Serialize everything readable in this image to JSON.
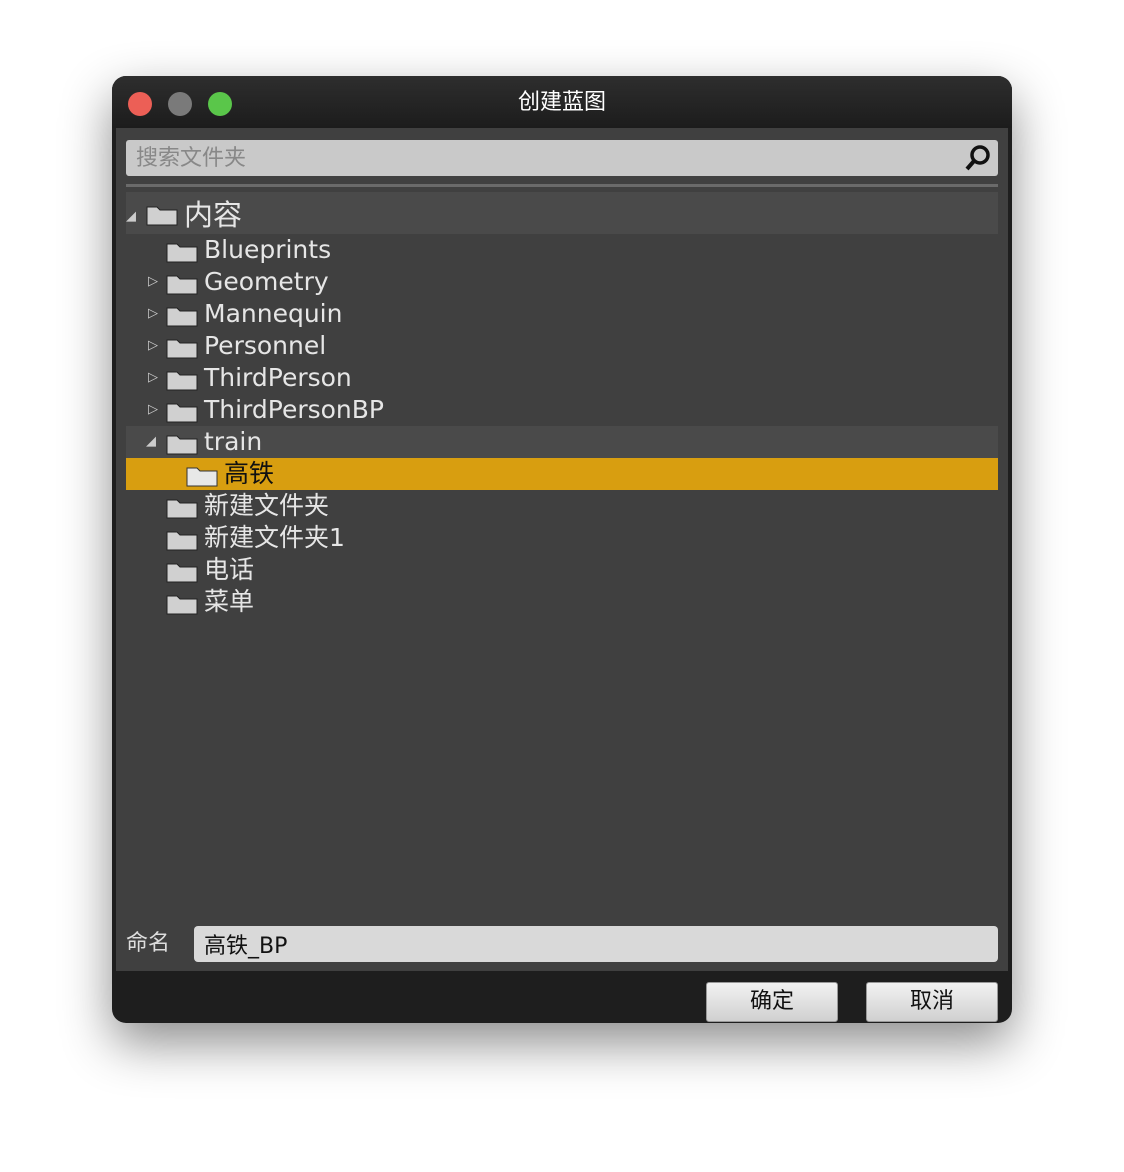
{
  "window": {
    "title": "创建蓝图",
    "traffic_lights": {
      "close": "#ec5f56",
      "minimize": "#7a7a7a",
      "maximize": "#5ac64a"
    }
  },
  "search": {
    "placeholder": "搜索文件夹",
    "icon": "search-icon"
  },
  "tree": [
    {
      "label": "内容",
      "level": 0,
      "expanded": true,
      "has_children": true,
      "highlighted": true
    },
    {
      "label": "Blueprints",
      "level": 1,
      "has_children": false
    },
    {
      "label": "Geometry",
      "level": 1,
      "has_children": true,
      "expanded": false
    },
    {
      "label": "Mannequin",
      "level": 1,
      "has_children": true,
      "expanded": false
    },
    {
      "label": "Personnel",
      "level": 1,
      "has_children": true,
      "expanded": false
    },
    {
      "label": "ThirdPerson",
      "level": 1,
      "has_children": true,
      "expanded": false
    },
    {
      "label": "ThirdPersonBP",
      "level": 1,
      "has_children": true,
      "expanded": false
    },
    {
      "label": "train",
      "level": 1,
      "has_children": true,
      "expanded": true,
      "highlighted": true
    },
    {
      "label": "高铁",
      "level": 2,
      "has_children": false,
      "selected": true
    },
    {
      "label": "新建文件夹",
      "level": 1,
      "has_children": false
    },
    {
      "label": "新建文件夹1",
      "level": 1,
      "has_children": false
    },
    {
      "label": "电话",
      "level": 1,
      "has_children": false
    },
    {
      "label": "菜单",
      "level": 1,
      "has_children": false
    }
  ],
  "name_field": {
    "label": "命名",
    "value": "高铁_BP"
  },
  "buttons": {
    "ok": "确定",
    "cancel": "取消"
  },
  "colors": {
    "selection": "#d89e10",
    "panel": "#404040"
  }
}
